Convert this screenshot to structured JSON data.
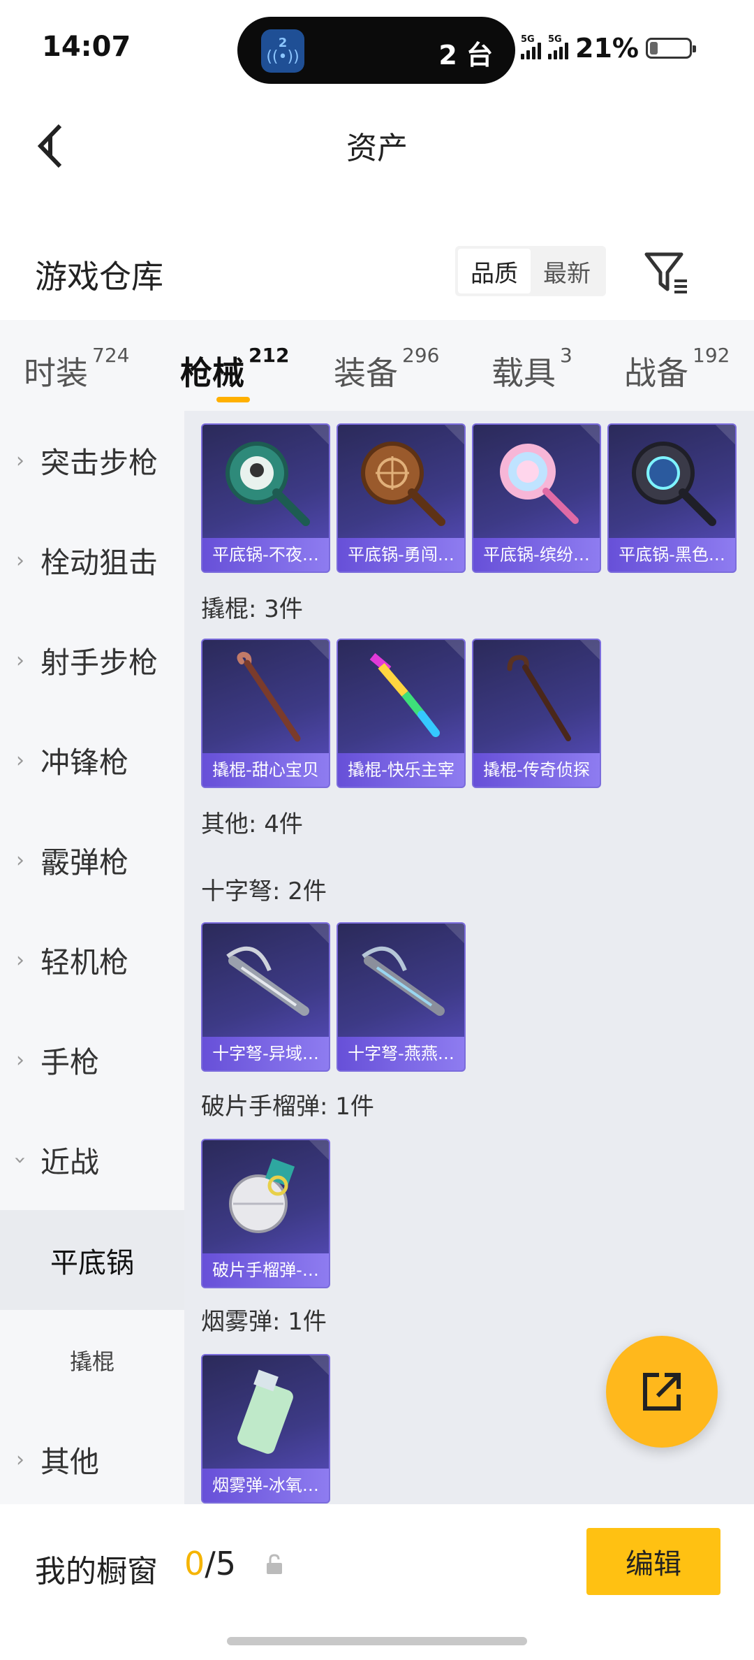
{
  "status": {
    "time": "14:07",
    "island_badge": "2",
    "island_text": "2 台",
    "sim1": "5G",
    "sim2": "5G",
    "battery_pct": "21%",
    "battery_level": 0.21
  },
  "nav": {
    "title": "资产"
  },
  "header": {
    "title": "游戏仓库",
    "sort_quality": "品质",
    "sort_latest": "最新"
  },
  "tabs": [
    {
      "label": "时装",
      "count": "724"
    },
    {
      "label": "枪械",
      "count": "212"
    },
    {
      "label": "装备",
      "count": "296"
    },
    {
      "label": "载具",
      "count": "3"
    },
    {
      "label": "战备",
      "count": "192"
    }
  ],
  "sidebar": [
    {
      "label": "突击步枪"
    },
    {
      "label": "栓动狙击"
    },
    {
      "label": "射手步枪"
    },
    {
      "label": "冲锋枪"
    },
    {
      "label": "霰弹枪"
    },
    {
      "label": "轻机枪"
    },
    {
      "label": "手枪"
    },
    {
      "label": "近战"
    },
    {
      "label": "平底锅"
    },
    {
      "label": "撬棍"
    },
    {
      "label": "其他"
    }
  ],
  "content": {
    "pans": [
      "平底锅-不夜…",
      "平底锅-勇闯…",
      "平底锅-缤纷…",
      "平底锅-黑色…"
    ],
    "crowbar_title": "撬棍: 3件",
    "crowbars": [
      "撬棍-甜心宝贝",
      "撬棍-快乐主宰",
      "撬棍-传奇侦探"
    ],
    "other_title": "其他: 4件",
    "crossbow_title": "十字弩: 2件",
    "crossbows": [
      "十字弩-异域…",
      "十字弩-燕燕…"
    ],
    "frag_title": "破片手榴弹: 1件",
    "frags": [
      "破片手榴弹-…"
    ],
    "smoke_title": "烟雾弹: 1件",
    "smokes": [
      "烟雾弹-冰氧…"
    ]
  },
  "bottom": {
    "label": "我的橱窗",
    "count_current": "0",
    "count_total": "/5",
    "edit_label": "编辑"
  }
}
